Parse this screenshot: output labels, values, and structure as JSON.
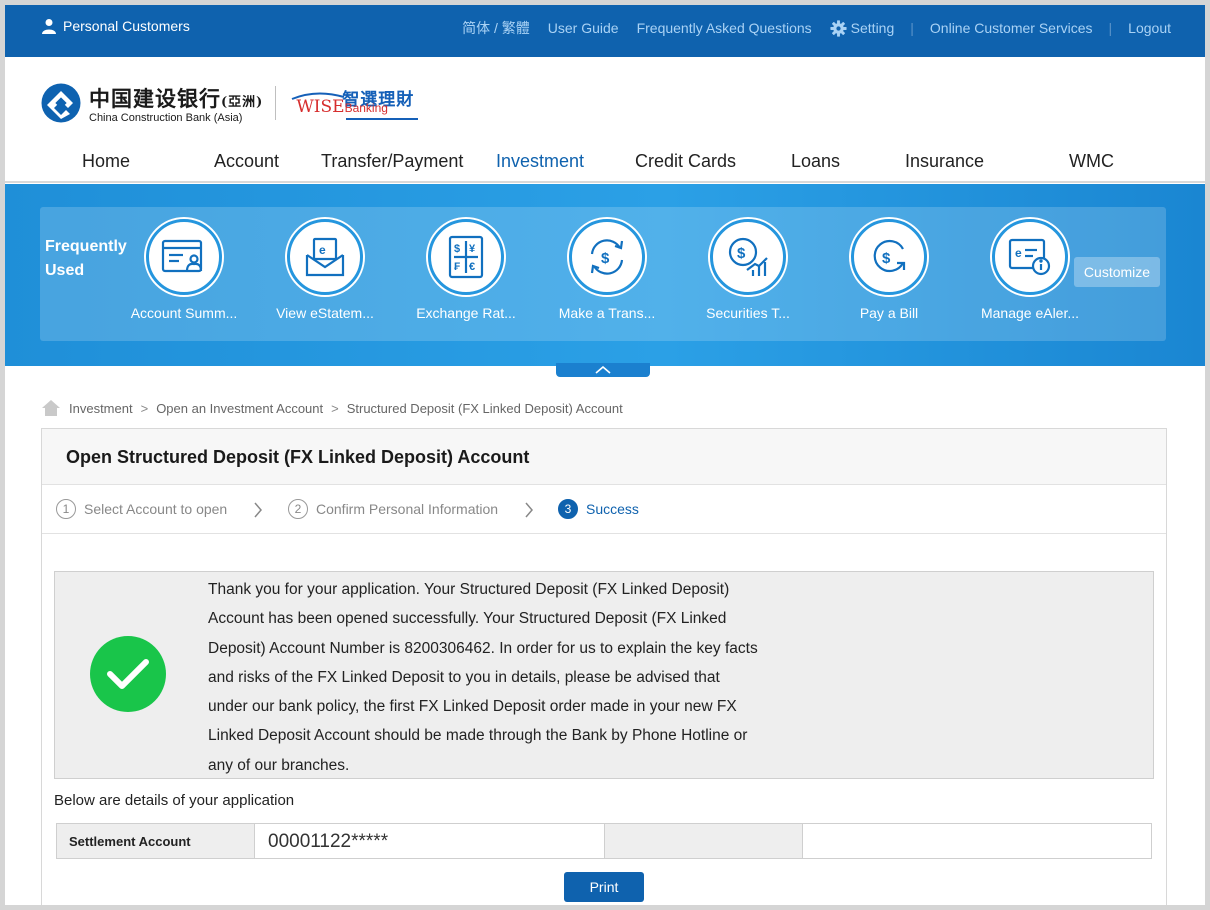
{
  "topbar": {
    "segment": "Personal Customers",
    "language": "简体 / 繁體",
    "user_guide": "User Guide",
    "faq": "Frequently Asked Questions",
    "setting": "Setting",
    "online_service": "Online Customer Services",
    "logout": "Logout"
  },
  "logo": {
    "bank_cn": "中国建设银行",
    "bank_cn_suffix": "(亞洲)",
    "bank_en": "China Construction Bank (Asia)",
    "wise_cn": "智選理財",
    "wise_en": "WISE",
    "wise_en_small": "Banking"
  },
  "nav": {
    "items": [
      {
        "label": "Home"
      },
      {
        "label": "Account"
      },
      {
        "label": "Transfer/Payment"
      },
      {
        "label": "Investment",
        "active": true
      },
      {
        "label": "Credit Cards"
      },
      {
        "label": "Loans"
      },
      {
        "label": "Insurance"
      },
      {
        "label": "WMC"
      }
    ],
    "active_color": "#0f62ae"
  },
  "favorites": {
    "title": "Frequently Used",
    "items": [
      {
        "label": "Account Summ...",
        "icon": "account-summary-icon"
      },
      {
        "label": "View eStatem...",
        "icon": "estatement-icon"
      },
      {
        "label": "Exchange Rat...",
        "icon": "exchange-rate-icon"
      },
      {
        "label": "Make a Trans...",
        "icon": "transfer-icon"
      },
      {
        "label": "Securities T...",
        "icon": "securities-icon"
      },
      {
        "label": "Pay a Bill",
        "icon": "pay-bill-icon"
      },
      {
        "label": "Manage eAler...",
        "icon": "ealert-icon"
      }
    ],
    "customize": "Customize"
  },
  "breadcrumb": {
    "items": [
      "Investment",
      "Open an Investment Account",
      "Structured Deposit (FX Linked Deposit) Account"
    ],
    "separator": ">"
  },
  "page": {
    "title": "Open Structured Deposit (FX Linked Deposit) Account",
    "steps": [
      {
        "num": "1",
        "label": "Select Account to open"
      },
      {
        "num": "2",
        "label": "Confirm Personal Information"
      },
      {
        "num": "3",
        "label": "Success",
        "active": true
      }
    ],
    "message_lines": [
      "Thank you for your application. Your Structured Deposit (FX Linked Deposit)",
      "Account has been opened successfully. Your Structured Deposit (FX Linked",
      "Deposit) Account Number is 8200306462. In order for us to explain the key facts",
      "and risks of the FX Linked Deposit to you in details, please be advised that",
      "under our bank policy, the first FX Linked Deposit order made in your new FX",
      "Linked Deposit Account should be made through the Bank by Phone Hotline or",
      "any of our branches."
    ],
    "details_heading": "Below are details of your application",
    "details": {
      "label": "Settlement Account",
      "value": "00001122*****"
    },
    "print": "Print",
    "success_color": "#19c54a"
  }
}
